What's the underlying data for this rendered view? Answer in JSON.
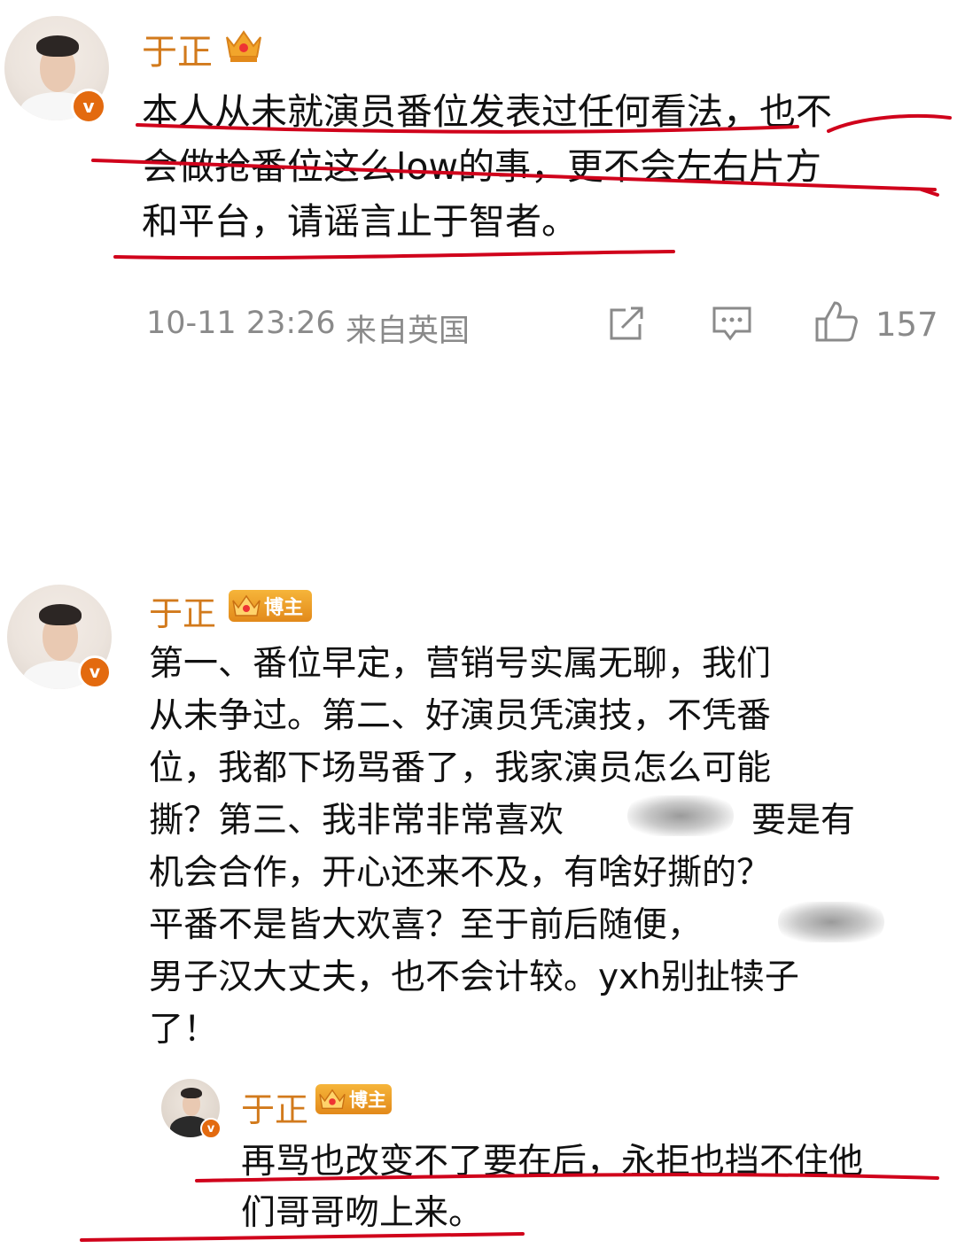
{
  "post": {
    "author": "于正",
    "lines": [
      "本人从未就演员番位发表过任何看法，也不",
      "会做抢番位这么low的事，更不会左右片方",
      "和平台，请谣言止于智者。"
    ],
    "time": "10-11 23:26",
    "location": "来自英国",
    "like_count": "157",
    "icons": [
      "share-icon",
      "comment-icon",
      "like-icon"
    ]
  },
  "comment": {
    "author": "于正",
    "badge": "博主",
    "lines": [
      "第一、番位早定，营销号实属无聊，我们",
      "从未争过。第二、好演员凭演技，不凭番",
      "位，我都下场骂番了，我家演员怎么可能",
      "撕？第三、我非常非常喜欢",
      "要是有",
      "机会合作，开心还来不及，有啥好撕的？",
      "平番不是皆大欢喜？至于前后随便，",
      "男子汉大丈夫，也不会计较。yxh别扯犊子",
      "了！"
    ]
  },
  "reply": {
    "author": "于正",
    "badge": "博主",
    "lines": [
      "再骂也改变不了要在后，永拒也挡不住他",
      "们哥哥吻上来。"
    ]
  },
  "colors": {
    "name": "#d27a1c",
    "badge": "#e8931f",
    "underline": "#d0021b",
    "meta": "#8a8a8a",
    "verified": "#e36a0f"
  }
}
